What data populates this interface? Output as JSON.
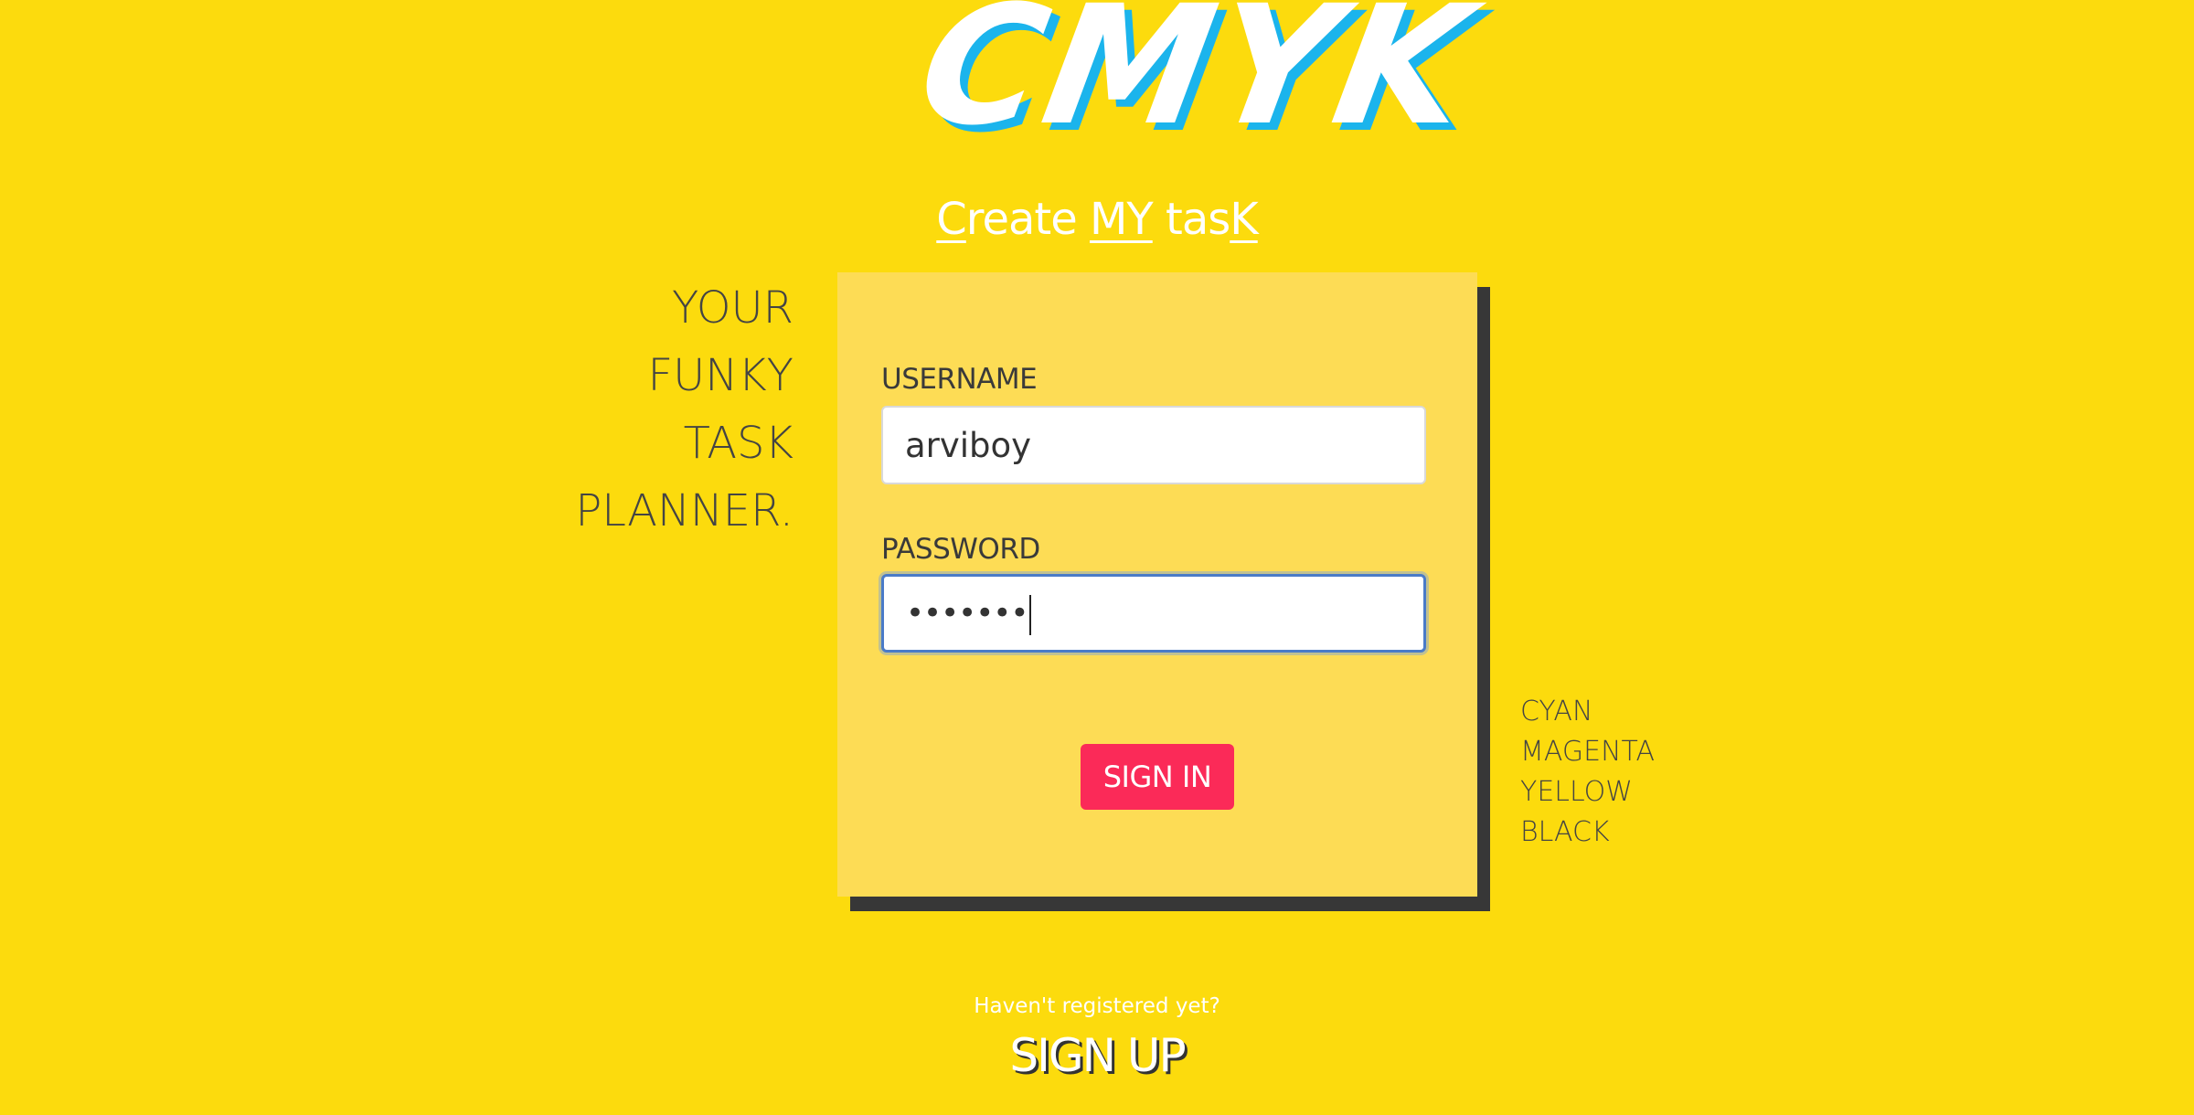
{
  "logo": {
    "text": "CMYK"
  },
  "tagline": {
    "part1_u": "C",
    "part1": "reate ",
    "part2_u": "MY",
    "part3": " tas",
    "part3_u": "K"
  },
  "slogan": [
    "YOUR",
    "FUNKY",
    "TASK",
    "PLANNER."
  ],
  "form": {
    "username_label": "USERNAME",
    "username_value": "arviboy",
    "password_label": "PASSWORD",
    "password_value": "•••••••",
    "signin_label": "SIGN IN"
  },
  "colors_list": [
    "CYAN",
    "MAGENTA",
    "YELLOW",
    "BLACK"
  ],
  "footer": {
    "register_prompt": "Haven't registered yet?",
    "signup_label": "SIGN UP"
  },
  "theme": {
    "background": "#FCDB0D",
    "card": "#FDDC55",
    "card_shadow": "#373737",
    "accent_cyan": "#1BB4EC",
    "button": "#FB2A58"
  }
}
